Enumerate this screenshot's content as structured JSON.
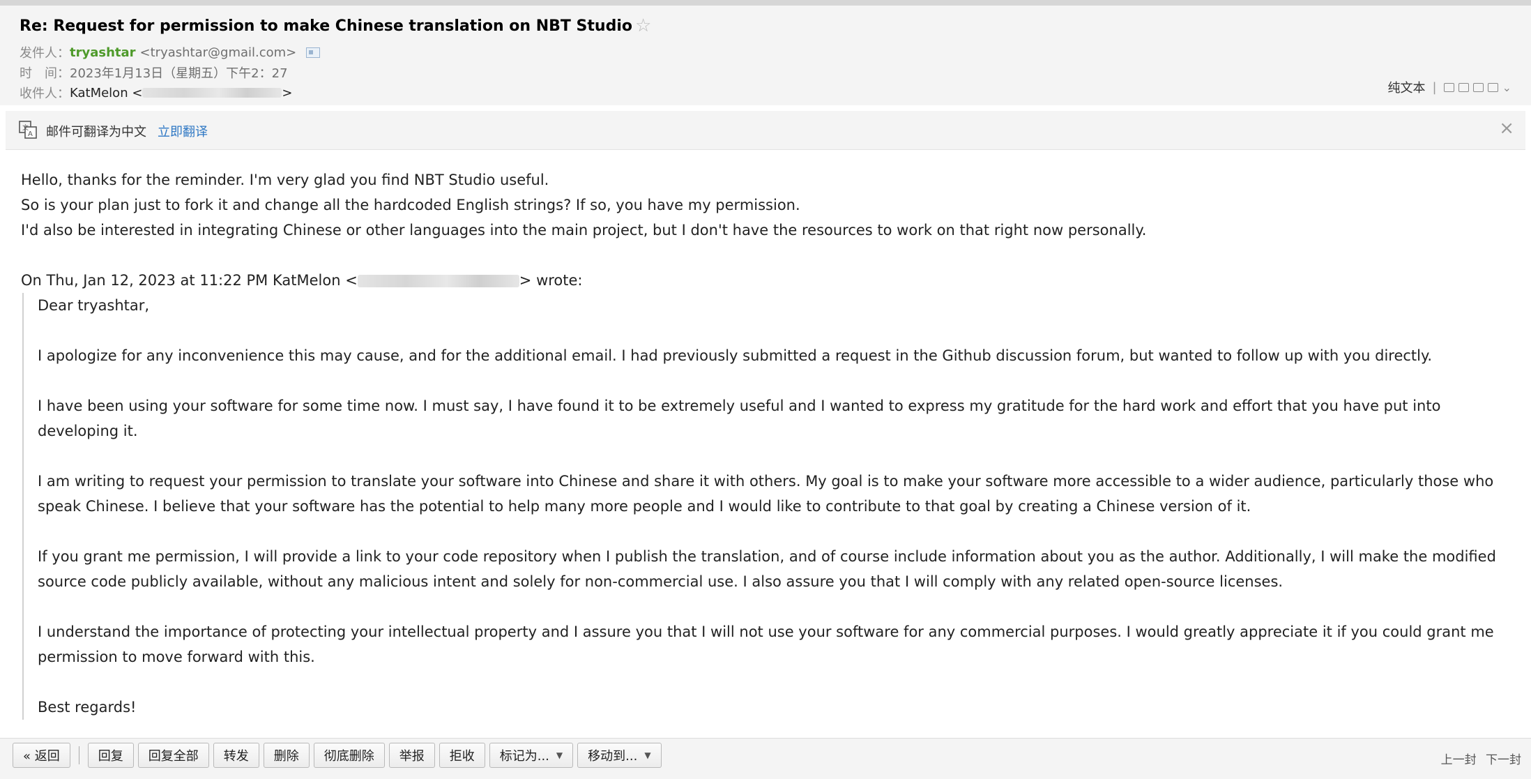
{
  "header": {
    "subject": "Re: Request for permission to make Chinese translation on NBT Studio",
    "star_icon": "star-outline-icon",
    "from_label": "发件人：",
    "from_name": "tryashtar",
    "from_email": "<tryashtar@gmail.com>",
    "time_label": "时　间：",
    "time_value": "2023年1月13日（星期五）下午2：27",
    "to_label": "收件人：",
    "to_name": "KatMelon <",
    "to_close": ">"
  },
  "tools": {
    "plain_text": "纯文本",
    "separator": "|"
  },
  "translate": {
    "text": "邮件可翻译为中文",
    "link": "立即翻译",
    "close": "×"
  },
  "body": {
    "reply": [
      "Hello, thanks for the reminder. I'm very glad you find NBT Studio useful.",
      "So is your plan just to fork it and change all the hardcoded English strings? If so, you have my permission.",
      "I'd also be interested in integrating Chinese or other languages into the main project, but I don't have the resources to work on that right now personally."
    ],
    "quote_header_prefix": "On Thu, Jan 12, 2023 at 11:22 PM KatMelon <",
    "quote_header_suffix": "> wrote:",
    "quoted": {
      "greeting": "Dear tryashtar,",
      "p1": "I apologize for any inconvenience this may cause, and for the additional email. I had previously submitted a request in the Github discussion forum, but wanted to follow up with you directly.",
      "p2": "I have been using your software for some time now. I must say, I have found it to be extremely useful and I wanted to express my gratitude for the hard work and effort that you have put into developing it.",
      "p3": "I am writing to request your permission to translate your software into Chinese and share it with others. My goal is to make your software more accessible to a wider audience, particularly those who speak Chinese. I believe that your software has the potential to help many more people and I would like to contribute to that goal by creating a Chinese version of it.",
      "p4": "If you grant me permission, I will provide a link to your code repository when I publish the translation, and of course include information about you as the author. Additionally, I will make the modified source code publicly available, without any malicious intent and solely for non-commercial use. I also assure you that I will comply with any related open-source licenses.",
      "p5": "I understand the importance of protecting your intellectual property and I assure you that I will not use your software for any commercial purposes. I would greatly appreciate it if you could grant me permission to move forward with this.",
      "closing": "Best regards!"
    }
  },
  "toolbar": {
    "back": "« 返回",
    "reply": "回复",
    "reply_all": "回复全部",
    "forward": "转发",
    "delete": "删除",
    "delete_perm": "彻底删除",
    "report": "举报",
    "reject": "拒收",
    "mark_as": "标记为...",
    "move_to": "移动到...",
    "prev": "上一封",
    "next": "下一封"
  }
}
